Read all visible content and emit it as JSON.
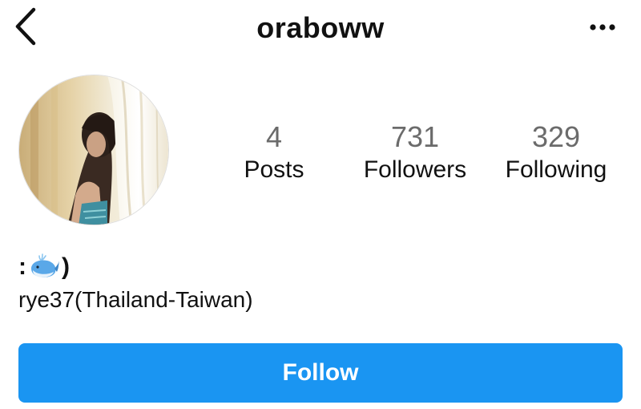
{
  "header": {
    "username": "oraboww",
    "back_icon": "chevron-left-icon",
    "more_icon": "more-horizontal-icon"
  },
  "profile": {
    "avatar": "profile-photo",
    "stats": [
      {
        "value": "4",
        "label": "Posts"
      },
      {
        "value": "731",
        "label": "Followers"
      },
      {
        "value": "329",
        "label": "Following"
      }
    ]
  },
  "bio": {
    "prefix": ":",
    "emoji_icon": "whale-icon",
    "suffix": ")",
    "line2": "rye37(Thailand-Taiwan)"
  },
  "actions": {
    "follow_label": "Follow"
  },
  "colors": {
    "follow_button": "#1a95f2",
    "stat_number": "#6b6b6b"
  }
}
